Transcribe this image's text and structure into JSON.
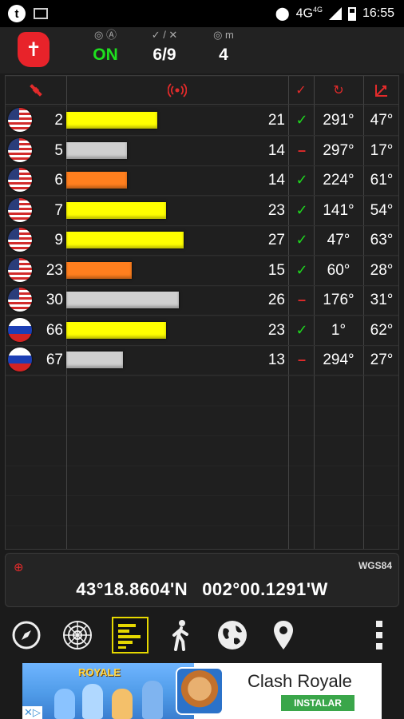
{
  "status_bar": {
    "network": "4G",
    "network_small": "4G",
    "time": "16:55"
  },
  "header": {
    "fix_icons": "◎ Ⓐ",
    "fix_value": "ON",
    "sats_icons": "✓ / ✕",
    "sats_value": "6/9",
    "accuracy_icons": "◎ m",
    "accuracy_value": "4"
  },
  "colors": {
    "yellow": "#ffff00",
    "orange": "#ff7f1e",
    "gray": "#cfcfcf",
    "accent_red": "#e32b2b",
    "ok_green": "#1ed81e"
  },
  "satellites": [
    {
      "flag": "us",
      "prn": "2",
      "snr": "21",
      "snr_level": 21,
      "bar_color": "yellow",
      "used": "✓",
      "used_ok": true,
      "azimuth": "291°",
      "elevation": "47°"
    },
    {
      "flag": "us",
      "prn": "5",
      "snr": "14",
      "snr_level": 14,
      "bar_color": "gray",
      "used": "–",
      "used_ok": false,
      "azimuth": "297°",
      "elevation": "17°"
    },
    {
      "flag": "us",
      "prn": "6",
      "snr": "14",
      "snr_level": 14,
      "bar_color": "orange",
      "used": "✓",
      "used_ok": true,
      "azimuth": "224°",
      "elevation": "61°"
    },
    {
      "flag": "us",
      "prn": "7",
      "snr": "23",
      "snr_level": 23,
      "bar_color": "yellow",
      "used": "✓",
      "used_ok": true,
      "azimuth": "141°",
      "elevation": "54°"
    },
    {
      "flag": "us",
      "prn": "9",
      "snr": "27",
      "snr_level": 27,
      "bar_color": "yellow",
      "used": "✓",
      "used_ok": true,
      "azimuth": "47°",
      "elevation": "63°"
    },
    {
      "flag": "us",
      "prn": "23",
      "snr": "15",
      "snr_level": 15,
      "bar_color": "orange",
      "used": "✓",
      "used_ok": true,
      "azimuth": "60°",
      "elevation": "28°"
    },
    {
      "flag": "us",
      "prn": "30",
      "snr": "26",
      "snr_level": 26,
      "bar_color": "gray",
      "used": "–",
      "used_ok": false,
      "azimuth": "176°",
      "elevation": "31°"
    },
    {
      "flag": "ru",
      "prn": "66",
      "snr": "23",
      "snr_level": 23,
      "bar_color": "yellow",
      "used": "✓",
      "used_ok": true,
      "azimuth": "1°",
      "elevation": "62°"
    },
    {
      "flag": "ru",
      "prn": "67",
      "snr": "13",
      "snr_level": 13,
      "bar_color": "gray",
      "used": "–",
      "used_ok": false,
      "azimuth": "294°",
      "elevation": "27°"
    }
  ],
  "position": {
    "datum": "WGS84",
    "latitude": "43°18.8604'N",
    "longitude": "002°00.1291'W"
  },
  "nav": [
    "compass-icon",
    "radar-icon",
    "signal-bars-icon",
    "walk-icon",
    "globe-icon",
    "map-pin-icon",
    "more-vert-icon"
  ],
  "ad": {
    "art_label": "ROYALE",
    "title": "Clash Royale",
    "button": "INSTALAR"
  }
}
